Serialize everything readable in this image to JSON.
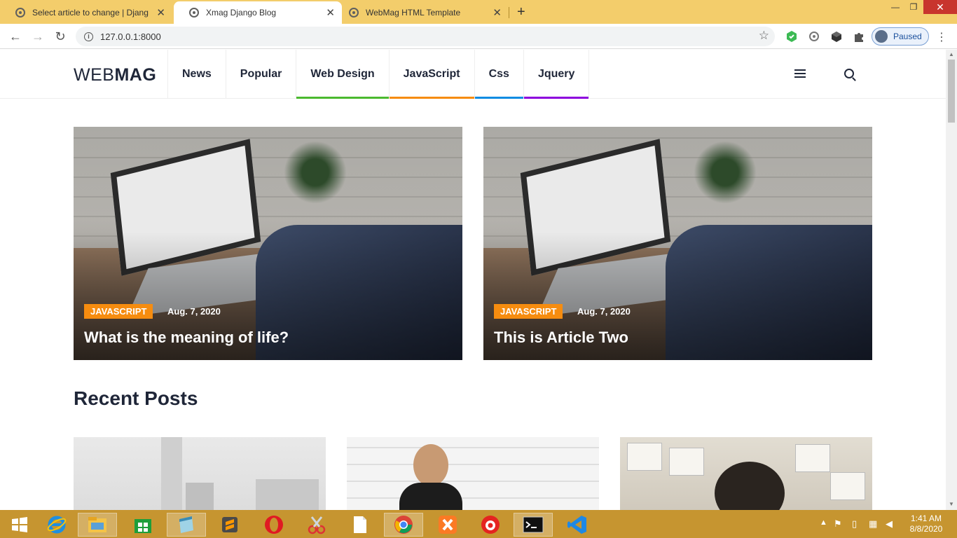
{
  "browser": {
    "tabs": [
      {
        "title": "Select article to change | Djang"
      },
      {
        "title": "Xmag Django Blog"
      },
      {
        "title": "WebMag HTML Template"
      }
    ],
    "close_glyph": "✕",
    "new_tab_glyph": "+",
    "url": "127.0.0.1:8000",
    "profile_status": "Paused",
    "back_icon": "←",
    "forward_icon": "→",
    "reload_icon": "↻",
    "star_icon": "☆",
    "info_icon": "i",
    "menu_icon": "⋮",
    "minimize": "—",
    "restore": "❐",
    "close_window": "✕"
  },
  "site": {
    "logo_light": "WEB",
    "logo_bold": "MAG",
    "nav": [
      {
        "label": "News",
        "color": ""
      },
      {
        "label": "Popular",
        "color": ""
      },
      {
        "label": "Web Design",
        "color": "#4bb92f"
      },
      {
        "label": "JavaScript",
        "color": "#f68c0f"
      },
      {
        "label": "Css",
        "color": "#0d8ce2"
      },
      {
        "label": "Jquery",
        "color": "#8d00de"
      }
    ]
  },
  "featured": [
    {
      "category": "JAVASCRIPT",
      "date": "Aug. 7, 2020",
      "title": "What is the meaning of life?"
    },
    {
      "category": "JAVASCRIPT",
      "date": "Aug. 7, 2020",
      "title": "This is Article Two"
    }
  ],
  "recent_heading": "Recent Posts",
  "taskbar": {
    "time": "1:41 AM",
    "date": "8/8/2020"
  }
}
